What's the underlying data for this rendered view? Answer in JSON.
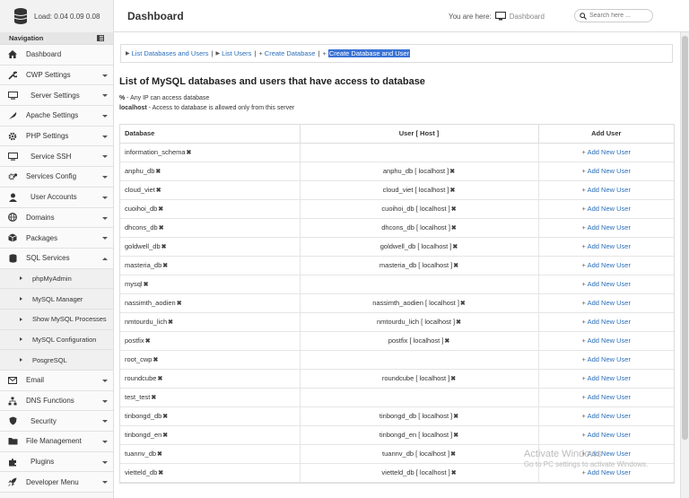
{
  "header": {
    "load_label": "Load: 0.04  0.09  0.08",
    "page_title": "Dashboard",
    "you_are_here": "You are here:",
    "breadcrumb_current": "Dashboard",
    "search_placeholder": "Search here ..."
  },
  "sidebar": {
    "nav_title": "Navigation",
    "items": [
      {
        "label": "Dashboard",
        "icon": "home-icon",
        "caret": false
      },
      {
        "label": "CWP Settings",
        "icon": "wrench-icon",
        "caret": true
      },
      {
        "label": "Server Settings",
        "icon": "server-icon",
        "caret": true
      },
      {
        "label": "Apache Settings",
        "icon": "feather-icon",
        "caret": true
      },
      {
        "label": "PHP Settings",
        "icon": "gear-icon",
        "caret": true
      },
      {
        "label": "Service SSH",
        "icon": "desktop-icon",
        "caret": true
      },
      {
        "label": "Services Config",
        "icon": "cogs-icon",
        "caret": true
      },
      {
        "label": "User Accounts",
        "icon": "user-icon",
        "caret": true
      },
      {
        "label": "Domains",
        "icon": "globe-icon",
        "caret": true
      },
      {
        "label": "Packages",
        "icon": "box-icon",
        "caret": true
      },
      {
        "label": "SQL Services",
        "icon": "database-icon",
        "caret": true
      }
    ],
    "sql_sub_items": [
      {
        "label": "phpMyAdmin"
      },
      {
        "label": "MySQL Manager"
      },
      {
        "label": "Show MySQL Processes"
      },
      {
        "label": "MySQL Configuration"
      },
      {
        "label": "PosgreSQL"
      }
    ],
    "items_after": [
      {
        "label": "Email",
        "icon": "envelope-icon",
        "caret": true
      },
      {
        "label": "DNS Functions",
        "icon": "sitemap-icon",
        "caret": true
      },
      {
        "label": "Security",
        "icon": "shield-icon",
        "caret": true
      },
      {
        "label": "File Management",
        "icon": "folder-icon",
        "caret": true
      },
      {
        "label": "Plugins",
        "icon": "puzzle-icon",
        "caret": true
      },
      {
        "label": "Developer Menu",
        "icon": "rocket-icon",
        "caret": true
      }
    ]
  },
  "link_bar": {
    "links": [
      {
        "label": "List Databases and Users",
        "prefix": "arrow"
      },
      {
        "label": "List Users",
        "prefix": "arrow"
      },
      {
        "label": "Create Database",
        "prefix": "plus"
      },
      {
        "label": "Create Database and User",
        "prefix": "plus",
        "selected": true
      }
    ]
  },
  "main": {
    "title": "List of MySQL databases and users that have access to database",
    "note1_key": "%",
    "note1_text": " - Any IP can access database",
    "note2_key": "localhost",
    "note2_text": " - Access to database is allowed only from this server"
  },
  "table": {
    "headers": [
      "Database",
      "User [ Host ]",
      "Add User"
    ],
    "add_label": "Add New User",
    "rows": [
      {
        "db": "information_schema",
        "user": ""
      },
      {
        "db": "anphu_db",
        "user": "anphu_db [ localhost ]"
      },
      {
        "db": "cloud_viet",
        "user": "cloud_viet [ localhost ]"
      },
      {
        "db": "cuoihoi_db",
        "user": "cuoihoi_db [ localhost ]"
      },
      {
        "db": "dhcons_db",
        "user": "dhcons_db [ localhost ]"
      },
      {
        "db": "goldwell_db",
        "user": "goldwell_db [ localhost ]"
      },
      {
        "db": "masteria_db",
        "user": "masteria_db [ localhost ]"
      },
      {
        "db": "mysql",
        "user": ""
      },
      {
        "db": "nassimth_aodien",
        "user": "nassimth_aodien [ localhost ]"
      },
      {
        "db": "nmtourdu_lich",
        "user": "nmtourdu_lich [ localhost ]"
      },
      {
        "db": "postfix",
        "user": "postfix [ localhost ]"
      },
      {
        "db": "root_cwp",
        "user": ""
      },
      {
        "db": "roundcube",
        "user": "roundcube [ localhost ]"
      },
      {
        "db": "test_test",
        "user": ""
      },
      {
        "db": "tinbongd_db",
        "user": "tinbongd_db [ localhost ]"
      },
      {
        "db": "tinbongd_en",
        "user": "tinbongd_en [ localhost ]"
      },
      {
        "db": "tuannv_db",
        "user": "tuannv_db [ localhost ]"
      },
      {
        "db": "vietteld_db",
        "user": "vietteld_db [ localhost ]"
      }
    ]
  },
  "watermark": {
    "line1": "Activate Windows",
    "line2": "Go to PC settings to activate Windows."
  }
}
